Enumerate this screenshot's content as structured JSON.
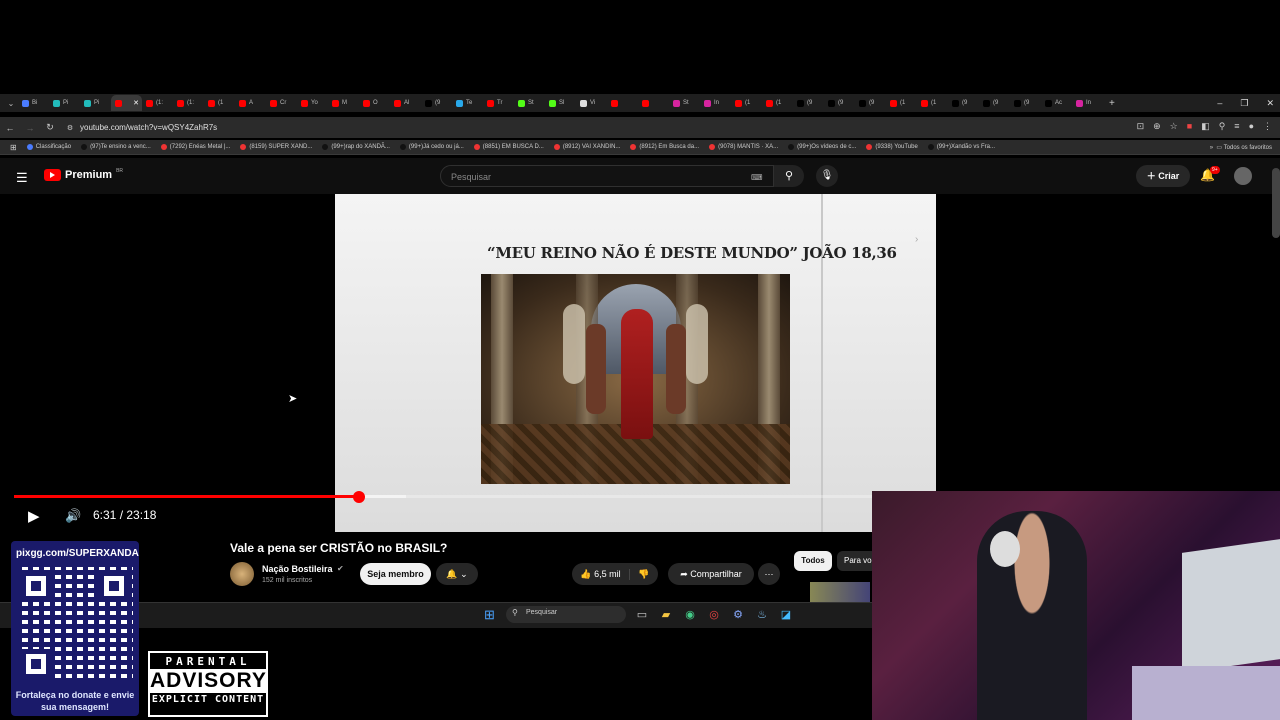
{
  "browser": {
    "tabs": [
      {
        "label": "Bi",
        "color": "#4a7cff"
      },
      {
        "label": "Pi",
        "color": "#2bb"
      },
      {
        "label": "Pi",
        "color": "#2bb"
      },
      {
        "label": "",
        "color": "#f00",
        "active": true
      },
      {
        "label": "(1:",
        "color": "#f00"
      },
      {
        "label": "(1:",
        "color": "#f00"
      },
      {
        "label": "(1",
        "color": "#f00"
      },
      {
        "label": "A",
        "color": "#f00"
      },
      {
        "label": "Cr",
        "color": "#f00"
      },
      {
        "label": "Yo",
        "color": "#f00"
      },
      {
        "label": "M",
        "color": "#f00"
      },
      {
        "label": "O",
        "color": "#f00"
      },
      {
        "label": "Al",
        "color": "#f00"
      },
      {
        "label": "(9",
        "color": "#000"
      },
      {
        "label": "Te",
        "color": "#29a9eb"
      },
      {
        "label": "Tr",
        "color": "#f00"
      },
      {
        "label": "St",
        "color": "#53fc18"
      },
      {
        "label": "Sl",
        "color": "#53fc18"
      },
      {
        "label": "Vi",
        "color": "#ddd"
      },
      {
        "label": "",
        "color": "#f00"
      },
      {
        "label": "",
        "color": "#f00"
      },
      {
        "label": "St",
        "color": "#d6249f"
      },
      {
        "label": "In",
        "color": "#d6249f"
      },
      {
        "label": "(1",
        "color": "#f00"
      },
      {
        "label": "(1",
        "color": "#f00"
      },
      {
        "label": "(9",
        "color": "#000"
      },
      {
        "label": "(9",
        "color": "#000"
      },
      {
        "label": "(9",
        "color": "#000"
      },
      {
        "label": "(1",
        "color": "#f00"
      },
      {
        "label": "(1",
        "color": "#f00"
      },
      {
        "label": "(9",
        "color": "#000"
      },
      {
        "label": "(9",
        "color": "#000"
      },
      {
        "label": "(9",
        "color": "#000"
      },
      {
        "label": "Ac",
        "color": "#000"
      },
      {
        "label": "In",
        "color": "#d6249f"
      }
    ],
    "close_tab": "✕",
    "new_tab": "+",
    "url": "youtube.com/watch?v=wQSY4ZahR7s",
    "bookmarks": [
      "Classificação",
      "(97)Te ensino a venc...",
      "(7292) Enéas Metal |...",
      "(8159) SUPER XAND...",
      "(99+)rap do XANDÃ...",
      "(99+)Já cedo ou já...",
      "(8851) EM BUSCA D...",
      "(8912) VAI XANDIN...",
      "(8912) Em Busca da...",
      "(9078) MANTIS · XA...",
      "(99+)Os vídeos de c...",
      "(9338) YouTube",
      "(99+)Xandão vs Fra..."
    ],
    "all_favorites": "Todos os favoritos"
  },
  "youtube": {
    "logo_text": "Premium",
    "logo_region": "BR",
    "search_placeholder": "Pesquisar",
    "create_label": "Criar",
    "notif_badge": "9+",
    "video_slide_title": "“MEU REINO NÃO É DESTE MUNDO” JOÃO 18,36",
    "current_time": "6:31 / 23:18",
    "progress": 0.375,
    "title": "Vale a pena ser CRISTÃO no BRASIL?",
    "channel": "Nação Bostileira",
    "subscribers": "152 mil inscritos",
    "member_label": "Seja membro",
    "likes": "6,5 mil",
    "share_label": "Compartilhar",
    "chips": [
      "Todos",
      "Para vo"
    ]
  },
  "taskbar": {
    "search_placeholder": "Pesquisar"
  },
  "overlay": {
    "donate_url": "pixgg.com/SUPERXANDA",
    "donate_message": "Fortaleça no donate e envie sua mensagem!",
    "advisory_top": "PARENTAL",
    "advisory_mid": "ADVISORY",
    "advisory_bottom": "EXPLICIT CONTENT"
  }
}
